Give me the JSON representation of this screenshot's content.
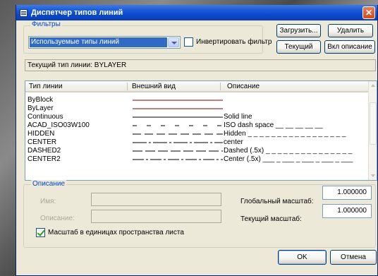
{
  "dialog": {
    "title": "Диспетчер типов линий",
    "close_label": "✕"
  },
  "filters": {
    "group_label": "Фильтры",
    "selected": "Используемые типы линий",
    "invert_label": "Инвертировать фильтр",
    "invert_checked": false
  },
  "buttons": {
    "load": "Загрузить...",
    "delete": "Удалить",
    "current": "Текущий",
    "details": "Вкл описание",
    "ok": "OK",
    "cancel": "Отмена"
  },
  "current_linetype": "Текущий тип линии: BYLAYER",
  "table": {
    "headers": [
      "Тип линии",
      "Внешний вид",
      "Описание"
    ],
    "rows": [
      {
        "name": "ByBlock",
        "pattern": "solid-dark",
        "description": ""
      },
      {
        "name": "ByLayer",
        "pattern": "solid-dark",
        "description": ""
      },
      {
        "name": "Continuous",
        "pattern": "solid",
        "description": "Solid line"
      },
      {
        "name": "ACAD_ISO03W100",
        "pattern": "iso-dash-space",
        "description": "ISO dash space __  __  __  __  __"
      },
      {
        "name": "HIDDEN",
        "pattern": "hidden",
        "description": "Hidden _ _ _ _ _ _ _ _ _ _ _ _ _ _ _ _ _"
      },
      {
        "name": "CENTER",
        "pattern": "center",
        "description": "center"
      },
      {
        "name": "DASHED2",
        "pattern": "dashed",
        "description": "Dashed (.5x) _ _ _ _ _ _ _ _ _ _ _ _ _ _ _"
      },
      {
        "name": "CENTER2",
        "pattern": "center2",
        "description": "Center (.5x) ___ _ ___ _ ___ _ ___ _ ___"
      }
    ]
  },
  "details": {
    "group_label": "Описание",
    "name_label": "Имя:",
    "description_label": "Описание:",
    "global_scale_label": "Глобальный масштаб:",
    "global_scale_value": "1.000000",
    "current_scale_label": "Текущий масштаб:",
    "current_scale_value": "1.000000",
    "paper_space_label": "Масштаб в единицах пространства листа",
    "paper_space_checked": true
  }
}
